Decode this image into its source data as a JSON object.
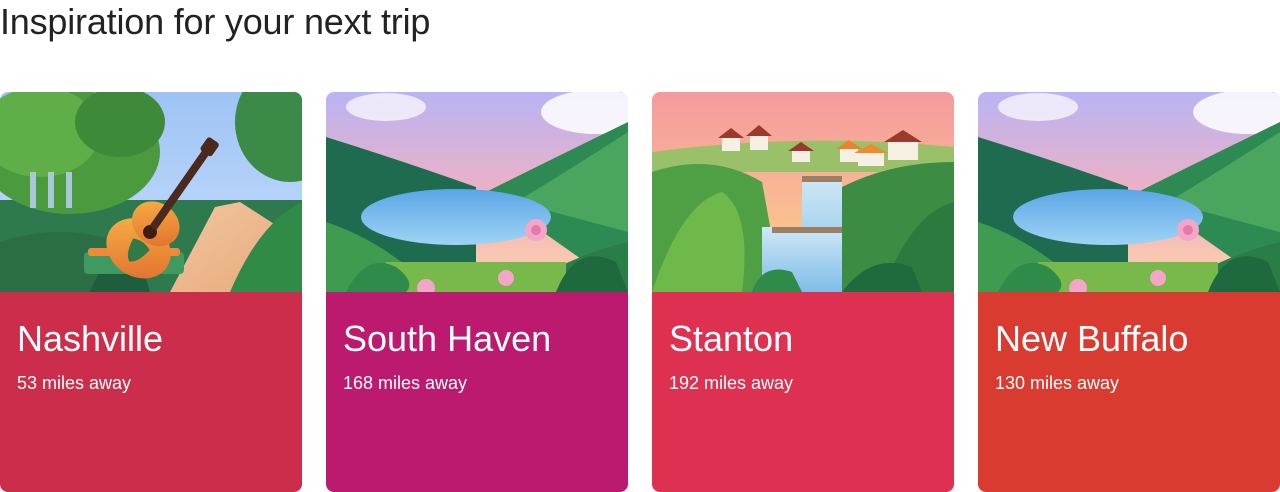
{
  "page": {
    "heading": "Inspiration for your next trip"
  },
  "cards": [
    {
      "title": "Nashville",
      "distance": "53 miles away",
      "illustration": "guitar-park-illustration",
      "color": "#CC2D4A"
    },
    {
      "title": "South Haven",
      "distance": "168 miles away",
      "illustration": "lake-valley-illustration",
      "color": "#BC1A6E"
    },
    {
      "title": "Stanton",
      "distance": "192 miles away",
      "illustration": "waterfall-village-illustration",
      "color": "#DE3151"
    },
    {
      "title": "New Buffalo",
      "distance": "130 miles away",
      "illustration": "lake-valley-illustration",
      "color": "#D93B30"
    }
  ]
}
